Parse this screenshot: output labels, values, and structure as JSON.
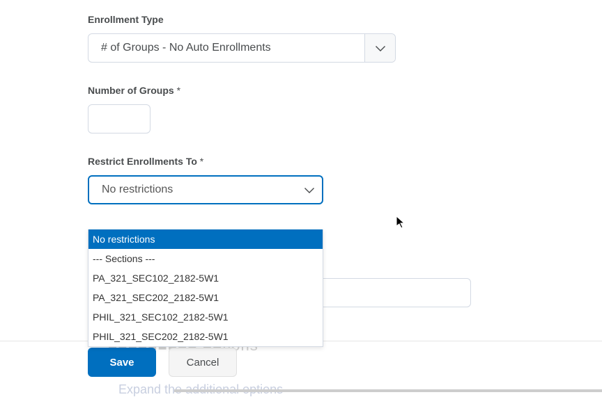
{
  "labels": {
    "enrollment_type": "Enrollment Type",
    "number_of_groups": "Number of Groups",
    "restrict_enrollments": "Restrict Enrollments To",
    "required": "*"
  },
  "enrollment_type": {
    "selected": "# of Groups - No Auto Enrollments"
  },
  "number_of_groups": {
    "value": ""
  },
  "restrict": {
    "value": "No restrictions",
    "options": [
      "No restrictions",
      "--- Sections ---",
      "PA_321_SEC102_2182-5W1",
      "PA_321_SEC202_2182-5W1",
      "PHIL_321_SEC102_2182-5W1",
      "PHIL_321_SEC202_2182-5W1"
    ],
    "selected_index": 0
  },
  "ghost": {
    "options_heading": "■■■■■■■■■ ■■tions",
    "expand": "Expand the additional options"
  },
  "buttons": {
    "save": "Save",
    "cancel": "Cancel"
  }
}
